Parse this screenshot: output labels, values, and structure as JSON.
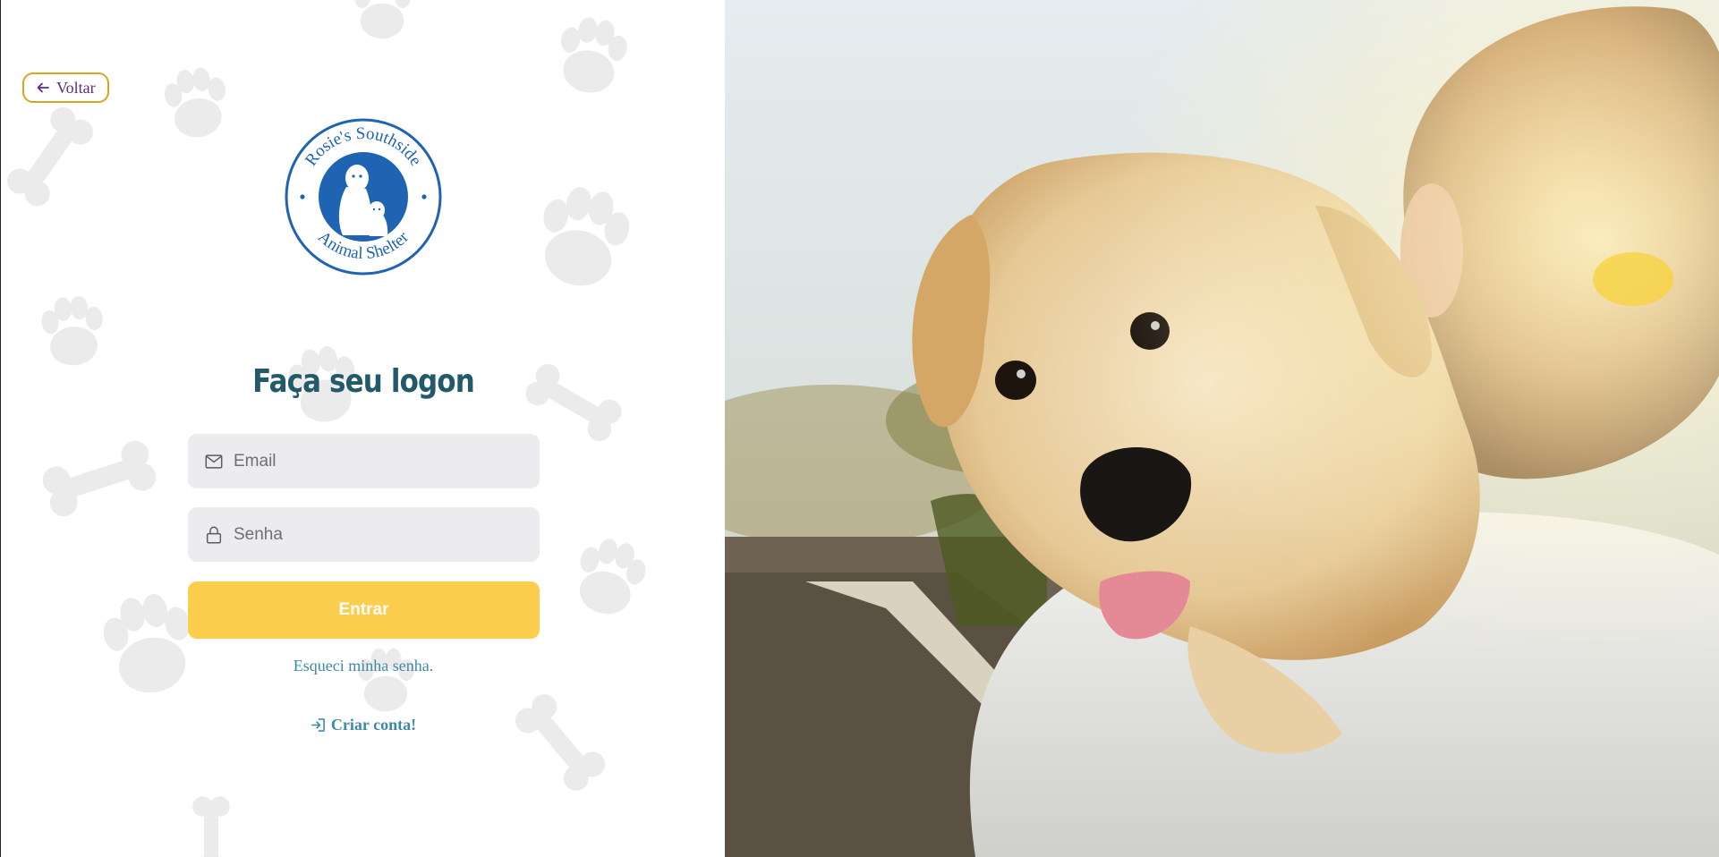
{
  "nav": {
    "back_label": "Voltar"
  },
  "logo": {
    "top_text": "Rosie's Southside",
    "bottom_text": "Animal Shelter",
    "color": "#1f63b3"
  },
  "login": {
    "title": "Faça seu logon",
    "email_placeholder": "Email",
    "password_placeholder": "Senha",
    "submit_label": "Entrar",
    "forgot_label": "Esqueci minha senha.",
    "create_label": "Criar conta!"
  },
  "colors": {
    "accent_yellow": "#fdcd4e",
    "title_teal": "#22596b",
    "link_teal": "#3d8aa6",
    "back_purple": "#5b2a86",
    "back_border": "#d9a521",
    "field_bg": "#ececee"
  },
  "icons": {
    "back": "arrow-left-icon",
    "email": "envelope-icon",
    "password": "lock-icon",
    "create": "sign-in-icon"
  },
  "photo": {
    "subject": "puppy-over-shoulder-photo"
  }
}
